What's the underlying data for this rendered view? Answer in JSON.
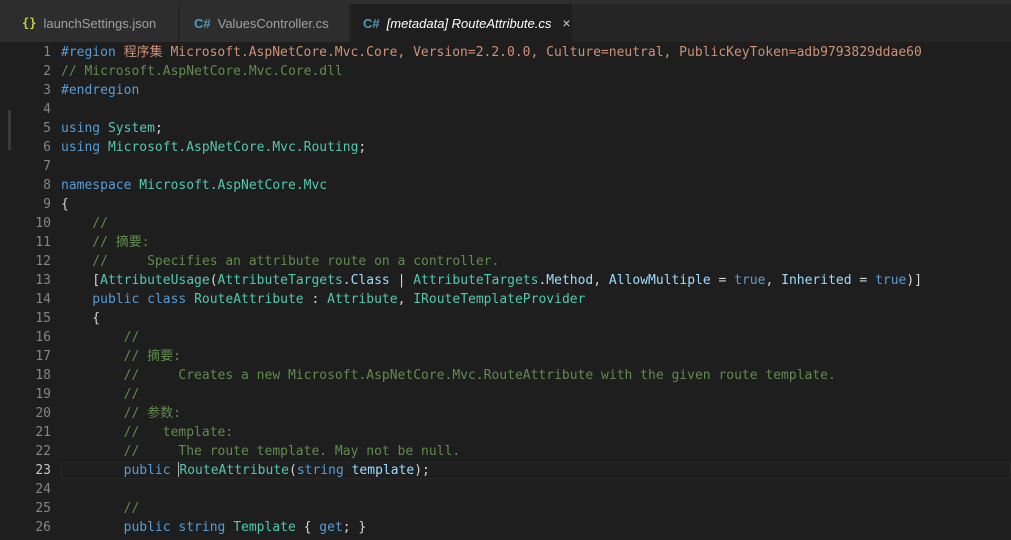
{
  "tabs": [
    {
      "label": "launchSettings.json",
      "icon": "json-braces-icon",
      "active": false
    },
    {
      "label": "ValuesController.cs",
      "icon": "csharp-file-icon",
      "active": false
    },
    {
      "label": "[metadata] RouteAttribute.cs",
      "icon": "csharp-file-icon",
      "active": true
    }
  ],
  "icons": {
    "json": "{}",
    "cs": "C#",
    "close": "×"
  },
  "editor": {
    "current_line": "23",
    "lines": [
      {
        "n": "1",
        "segs": [
          [
            "#region ",
            "kw"
          ],
          [
            "程序集 Microsoft.AspNetCore.Mvc.Core, Version=2.2.0.0, Culture=neutral, PublicKeyToken=adb9793829ddae60",
            "str"
          ]
        ]
      },
      {
        "n": "2",
        "segs": [
          [
            "// Microsoft.AspNetCore.Mvc.Core.dll",
            "cm"
          ]
        ]
      },
      {
        "n": "3",
        "segs": [
          [
            "#endregion",
            "kw"
          ]
        ]
      },
      {
        "n": "4",
        "segs": []
      },
      {
        "n": "5",
        "segs": [
          [
            "using ",
            "kw"
          ],
          [
            "System",
            "ns"
          ],
          [
            ";",
            "pl"
          ]
        ]
      },
      {
        "n": "6",
        "segs": [
          [
            "using ",
            "kw"
          ],
          [
            "Microsoft.AspNetCore.Mvc.Routing",
            "ns"
          ],
          [
            ";",
            "pl"
          ]
        ]
      },
      {
        "n": "7",
        "segs": []
      },
      {
        "n": "8",
        "segs": [
          [
            "namespace ",
            "kw"
          ],
          [
            "Microsoft.AspNetCore.Mvc",
            "ns"
          ]
        ]
      },
      {
        "n": "9",
        "segs": [
          [
            "{",
            "pl"
          ]
        ]
      },
      {
        "n": "10",
        "segs": [
          [
            "    //",
            "cm"
          ]
        ]
      },
      {
        "n": "11",
        "segs": [
          [
            "    // 摘要:",
            "cm"
          ]
        ]
      },
      {
        "n": "12",
        "segs": [
          [
            "    //     Specifies an attribute route on a controller.",
            "cm"
          ]
        ]
      },
      {
        "n": "13",
        "segs": [
          [
            "    [",
            "pl"
          ],
          [
            "AttributeUsage",
            "ty"
          ],
          [
            "(",
            "pl"
          ],
          [
            "AttributeTargets",
            "ty"
          ],
          [
            ".",
            "pl"
          ],
          [
            "Class",
            "id"
          ],
          [
            " | ",
            "pl"
          ],
          [
            "AttributeTargets",
            "ty"
          ],
          [
            ".",
            "pl"
          ],
          [
            "Method",
            "id"
          ],
          [
            ", ",
            "pl"
          ],
          [
            "AllowMultiple",
            "id"
          ],
          [
            " = ",
            "pl"
          ],
          [
            "true",
            "kw"
          ],
          [
            ", ",
            "pl"
          ],
          [
            "Inherited",
            "id"
          ],
          [
            " = ",
            "pl"
          ],
          [
            "true",
            "kw"
          ],
          [
            ")]",
            "pl"
          ]
        ]
      },
      {
        "n": "14",
        "segs": [
          [
            "    public class ",
            "kw"
          ],
          [
            "RouteAttribute",
            "ty"
          ],
          [
            " : ",
            "pl"
          ],
          [
            "Attribute",
            "ty"
          ],
          [
            ", ",
            "pl"
          ],
          [
            "IRouteTemplateProvider",
            "ty"
          ]
        ]
      },
      {
        "n": "15",
        "segs": [
          [
            "    {",
            "pl"
          ]
        ]
      },
      {
        "n": "16",
        "segs": [
          [
            "        //",
            "cm"
          ]
        ]
      },
      {
        "n": "17",
        "segs": [
          [
            "        // 摘要:",
            "cm"
          ]
        ]
      },
      {
        "n": "18",
        "segs": [
          [
            "        //     Creates a new Microsoft.AspNetCore.Mvc.RouteAttribute with the given route template.",
            "cm"
          ]
        ]
      },
      {
        "n": "19",
        "segs": [
          [
            "        //",
            "cm"
          ]
        ]
      },
      {
        "n": "20",
        "segs": [
          [
            "        // 参数:",
            "cm"
          ]
        ]
      },
      {
        "n": "21",
        "segs": [
          [
            "        //   template:",
            "cm"
          ]
        ]
      },
      {
        "n": "22",
        "segs": [
          [
            "        //     The route template. May not be null.",
            "cm"
          ]
        ]
      },
      {
        "n": "23",
        "segs": [
          [
            "        public ",
            "kw"
          ],
          [
            "|",
            ""
          ],
          [
            "RouteAttribute",
            "ty"
          ],
          [
            "(",
            "pl"
          ],
          [
            "string ",
            "kw"
          ],
          [
            "template",
            "id"
          ],
          [
            ");",
            "pl"
          ]
        ]
      },
      {
        "n": "24",
        "segs": []
      },
      {
        "n": "25",
        "segs": [
          [
            "        //",
            "cm"
          ]
        ]
      },
      {
        "n": "26",
        "segs": [
          [
            "        public string ",
            "kw"
          ],
          [
            "Template",
            "ty"
          ],
          [
            " { ",
            "pl"
          ],
          [
            "get",
            "kw"
          ],
          [
            "; }",
            "pl"
          ]
        ]
      }
    ]
  }
}
